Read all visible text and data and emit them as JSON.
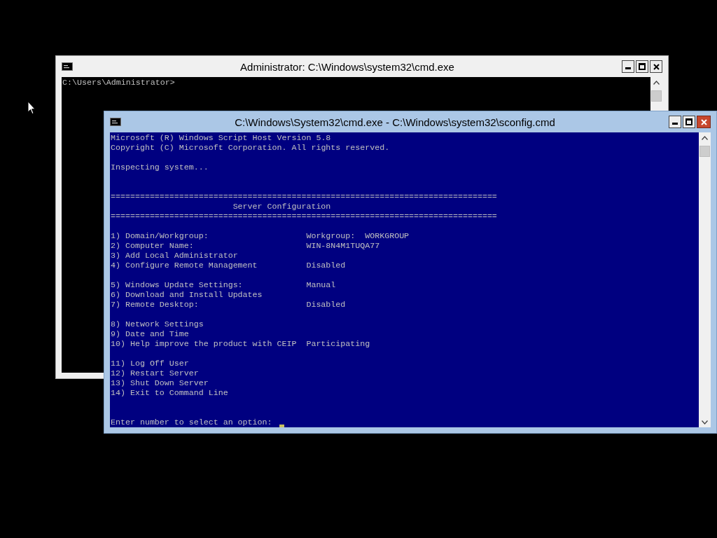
{
  "windows": [
    {
      "title": "Administrator: C:\\Windows\\system32\\cmd.exe",
      "active": false,
      "kind": "black",
      "blocks": [
        {
          "kind": "text",
          "lines": [
            {
              "label": "C:\\Users\\Administrator>"
            }
          ]
        }
      ]
    },
    {
      "title": "C:\\Windows\\System32\\cmd.exe - C:\\Windows\\system32\\sconfig.cmd",
      "active": true,
      "kind": "blue",
      "blocks": [
        {
          "kind": "text",
          "lines": [
            {
              "label": "Microsoft (R) Windows Script Host Version 5.8"
            },
            {
              "label": "Copyright (C) Microsoft Corporation. All rights reserved."
            }
          ]
        },
        {
          "kind": "text",
          "lines": [
            {
              "label": "Inspecting system..."
            }
          ]
        },
        {
          "kind": "banner",
          "lines": [
            {
              "label": "==============================================================================="
            },
            {
              "label": "Server Configuration"
            },
            {
              "label": "==============================================================================="
            }
          ]
        },
        {
          "kind": "menu",
          "lines": [
            {
              "label": "1) Domain/Workgroup:",
              "value": "Workgroup:  WORKGROUP"
            },
            {
              "label": "2) Computer Name:",
              "value": "WIN-8N4M1TUQA77"
            },
            {
              "label": "3) Add Local Administrator"
            },
            {
              "label": "4) Configure Remote Management",
              "value": "Disabled"
            }
          ]
        },
        {
          "kind": "menu",
          "lines": [
            {
              "label": "5) Windows Update Settings:",
              "value": "Manual"
            },
            {
              "label": "6) Download and Install Updates"
            },
            {
              "label": "7) Remote Desktop:",
              "value": "Disabled"
            }
          ]
        },
        {
          "kind": "menu",
          "lines": [
            {
              "label": "8) Network Settings"
            },
            {
              "label": "9) Date and Time"
            },
            {
              "label": "10) Help improve the product with CEIP",
              "value": "Participating"
            }
          ]
        },
        {
          "kind": "menu",
          "lines": [
            {
              "label": "11) Log Off User"
            },
            {
              "label": "12) Restart Server"
            },
            {
              "label": "13) Shut Down Server"
            },
            {
              "label": "14) Exit to Command Line"
            }
          ]
        },
        {
          "kind": "prompt",
          "lines": [
            {
              "label": "Enter number to select an option:"
            }
          ]
        }
      ]
    }
  ]
}
